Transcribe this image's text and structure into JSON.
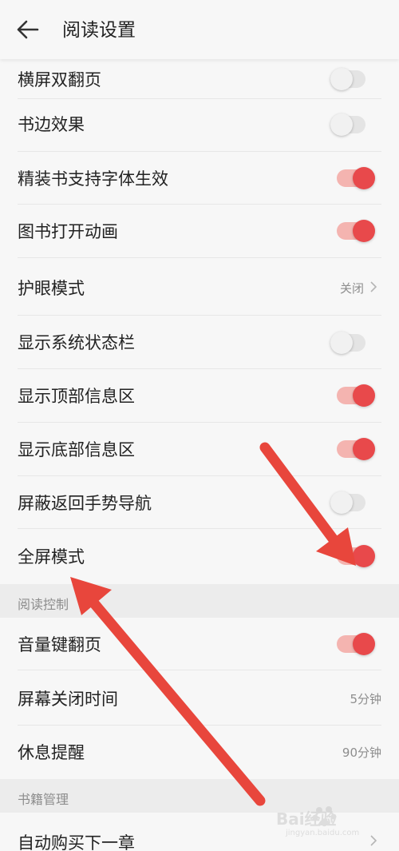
{
  "header": {
    "title": "阅读设置",
    "back_icon": "arrow-left-icon"
  },
  "rows_group1": [
    {
      "label": "横屏双翻页",
      "toggle": false
    },
    {
      "label": "书边效果",
      "toggle": false
    },
    {
      "label": "精装书支持字体生效",
      "toggle": true
    },
    {
      "label": "图书打开动画",
      "toggle": true
    },
    {
      "label": "护眼模式",
      "value": "关闭"
    },
    {
      "label": "显示系统状态栏",
      "toggle": false
    },
    {
      "label": "显示顶部信息区",
      "toggle": true
    },
    {
      "label": "显示底部信息区",
      "toggle": true
    },
    {
      "label": "屏蔽返回手势导航",
      "toggle": false
    },
    {
      "label": "全屏模式",
      "toggle": true
    }
  ],
  "section_reading": {
    "title": "阅读控制"
  },
  "rows_group2": [
    {
      "label": "音量键翻页",
      "toggle": true
    },
    {
      "label": "屏幕关闭时间",
      "value": "5分钟"
    },
    {
      "label": "休息提醒",
      "value": "90分钟"
    }
  ],
  "section_books": {
    "title": "书籍管理"
  },
  "rows_group3": [
    {
      "label": "自动购买下一章"
    }
  ],
  "colors": {
    "accent": "#e8494b",
    "accent_track": "#f4b4b0",
    "arrow": "#e8463c"
  },
  "watermark": {
    "text": "Bai经验",
    "sub": "jingyan.baidu.com"
  }
}
